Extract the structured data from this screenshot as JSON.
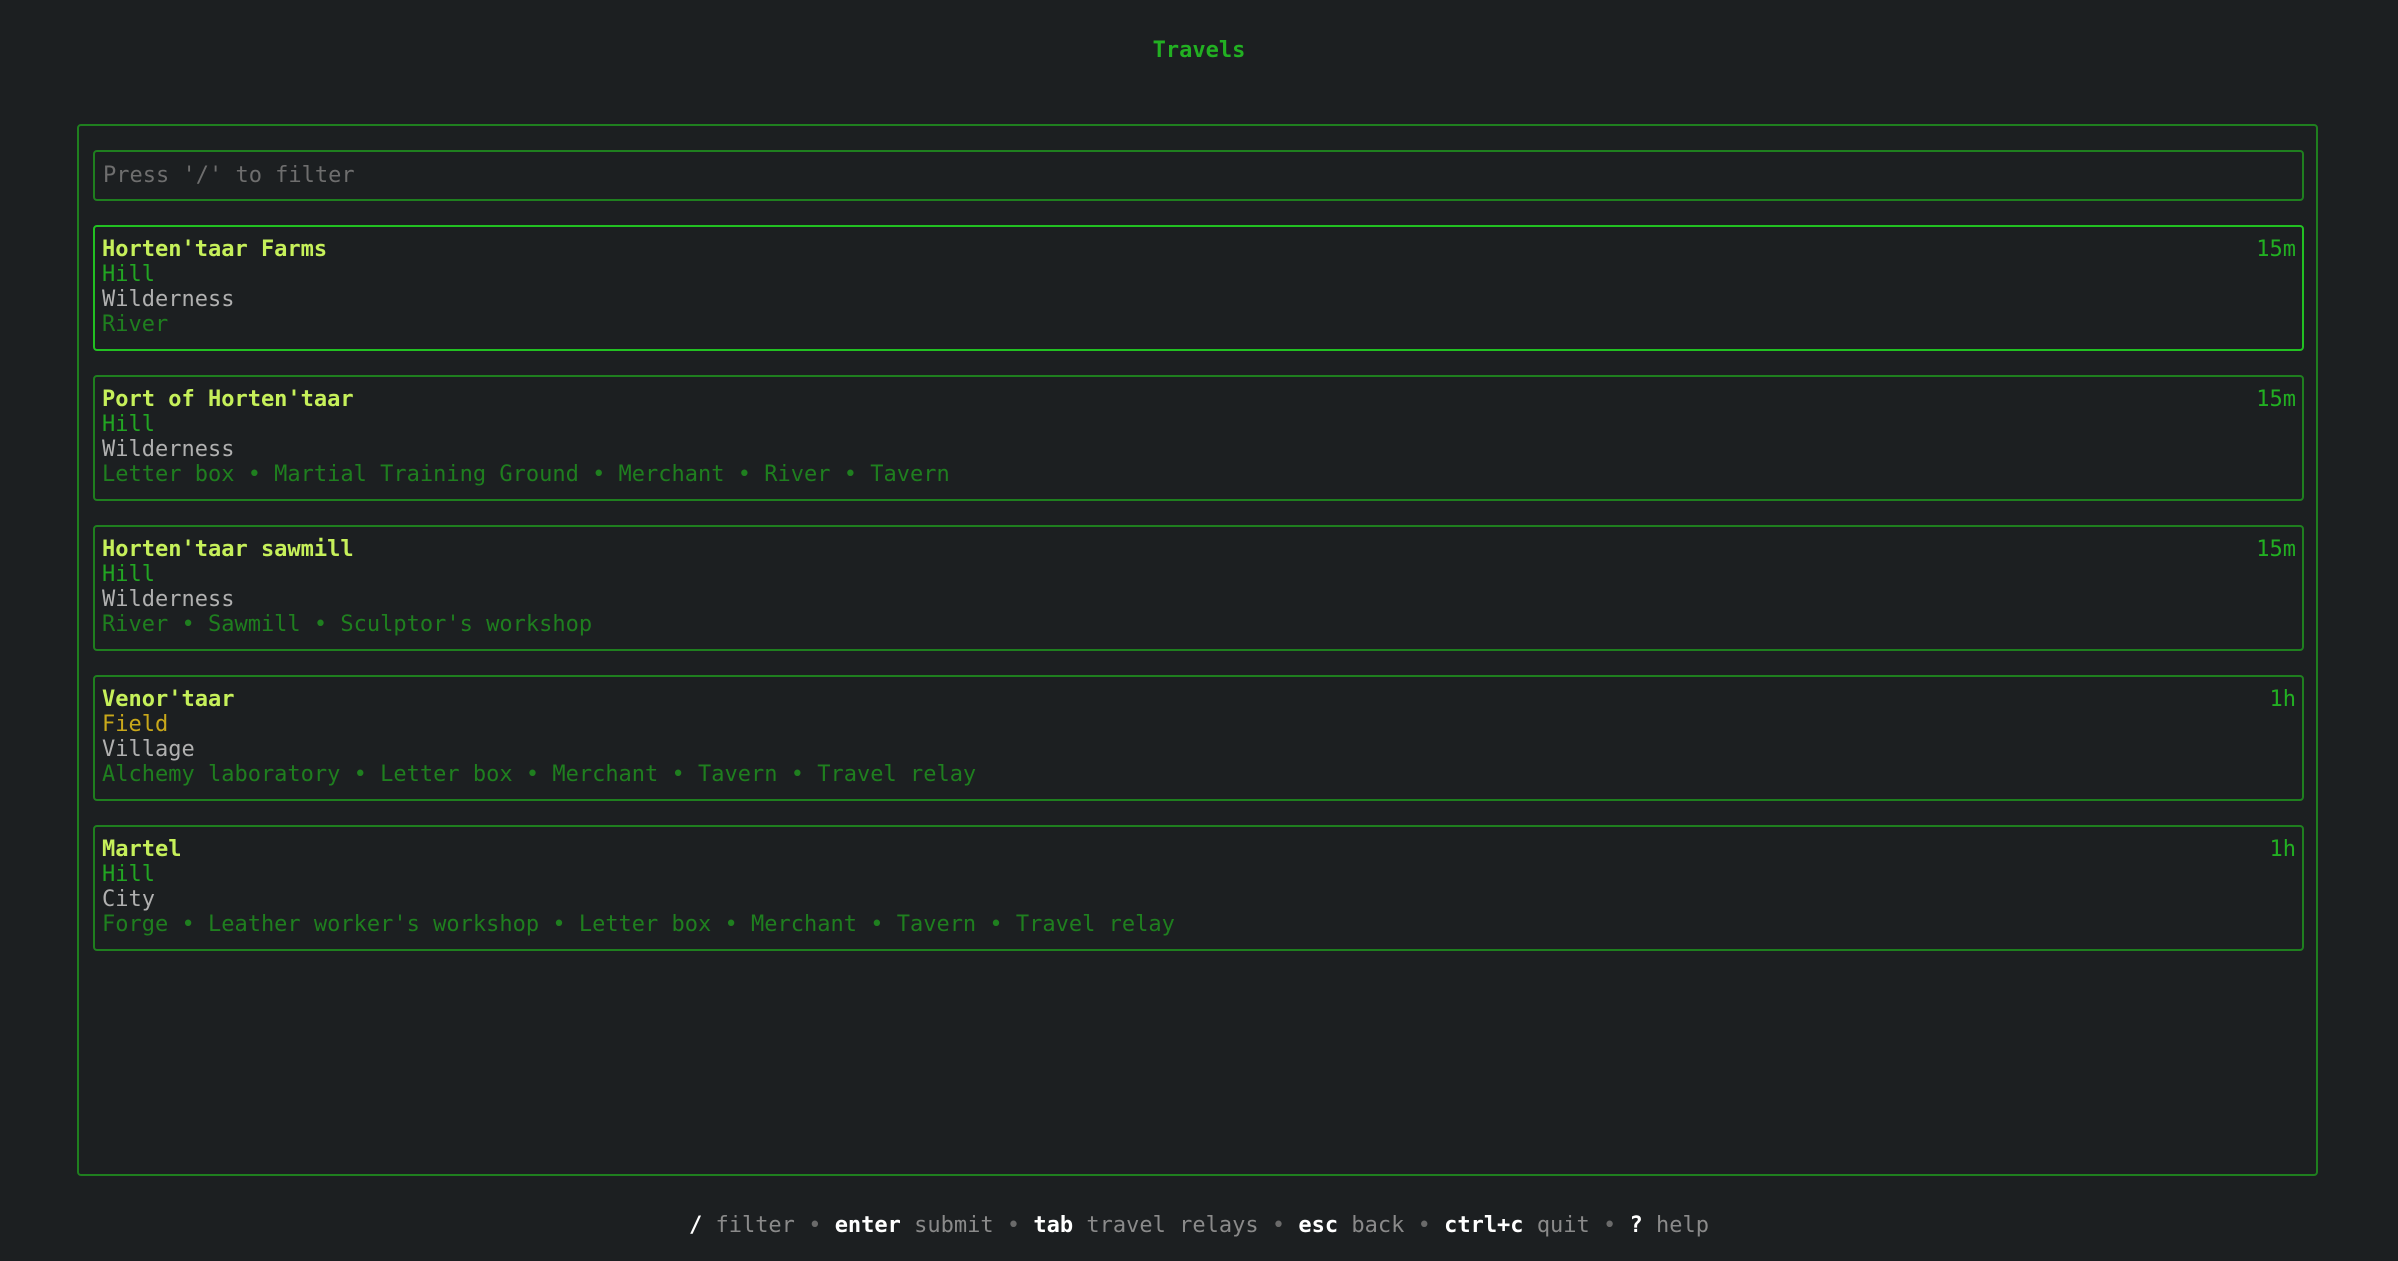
{
  "title": "Travels",
  "filter": {
    "placeholder": "Press '/' to filter",
    "value": ""
  },
  "colors": {
    "background": "#1c1f21",
    "accent": "#22b022",
    "border": "#1f7f1f",
    "name": "#c6f05a",
    "field": "#c9a81a"
  },
  "destinations": [
    {
      "name": "Horten'taar Farms",
      "terrain": "Hill",
      "type": "Wilderness",
      "features": "River",
      "time": "15m",
      "selected": true
    },
    {
      "name": "Port of Horten'taar",
      "terrain": "Hill",
      "type": "Wilderness",
      "features": "Letter box • Martial Training Ground • Merchant • River • Tavern",
      "time": "15m",
      "selected": false
    },
    {
      "name": "Horten'taar sawmill",
      "terrain": "Hill",
      "type": "Wilderness",
      "features": "River • Sawmill • Sculptor's workshop",
      "time": "15m",
      "selected": false
    },
    {
      "name": "Venor'taar",
      "terrain": "Field",
      "type": "Village",
      "features": "Alchemy laboratory • Letter box • Merchant • Tavern • Travel relay",
      "time": "1h",
      "selected": false
    },
    {
      "name": "Martel",
      "terrain": "Hill",
      "type": "City",
      "features": "Forge • Leather worker's workshop • Letter box • Merchant • Tavern • Travel relay",
      "time": "1h",
      "selected": false
    }
  ],
  "help": {
    "separator": "•",
    "items": [
      {
        "key": "/",
        "desc": "filter"
      },
      {
        "key": "enter",
        "desc": "submit"
      },
      {
        "key": "tab",
        "desc": "travel relays"
      },
      {
        "key": "esc",
        "desc": "back"
      },
      {
        "key": "ctrl+c",
        "desc": "quit"
      },
      {
        "key": "?",
        "desc": "help"
      }
    ]
  }
}
